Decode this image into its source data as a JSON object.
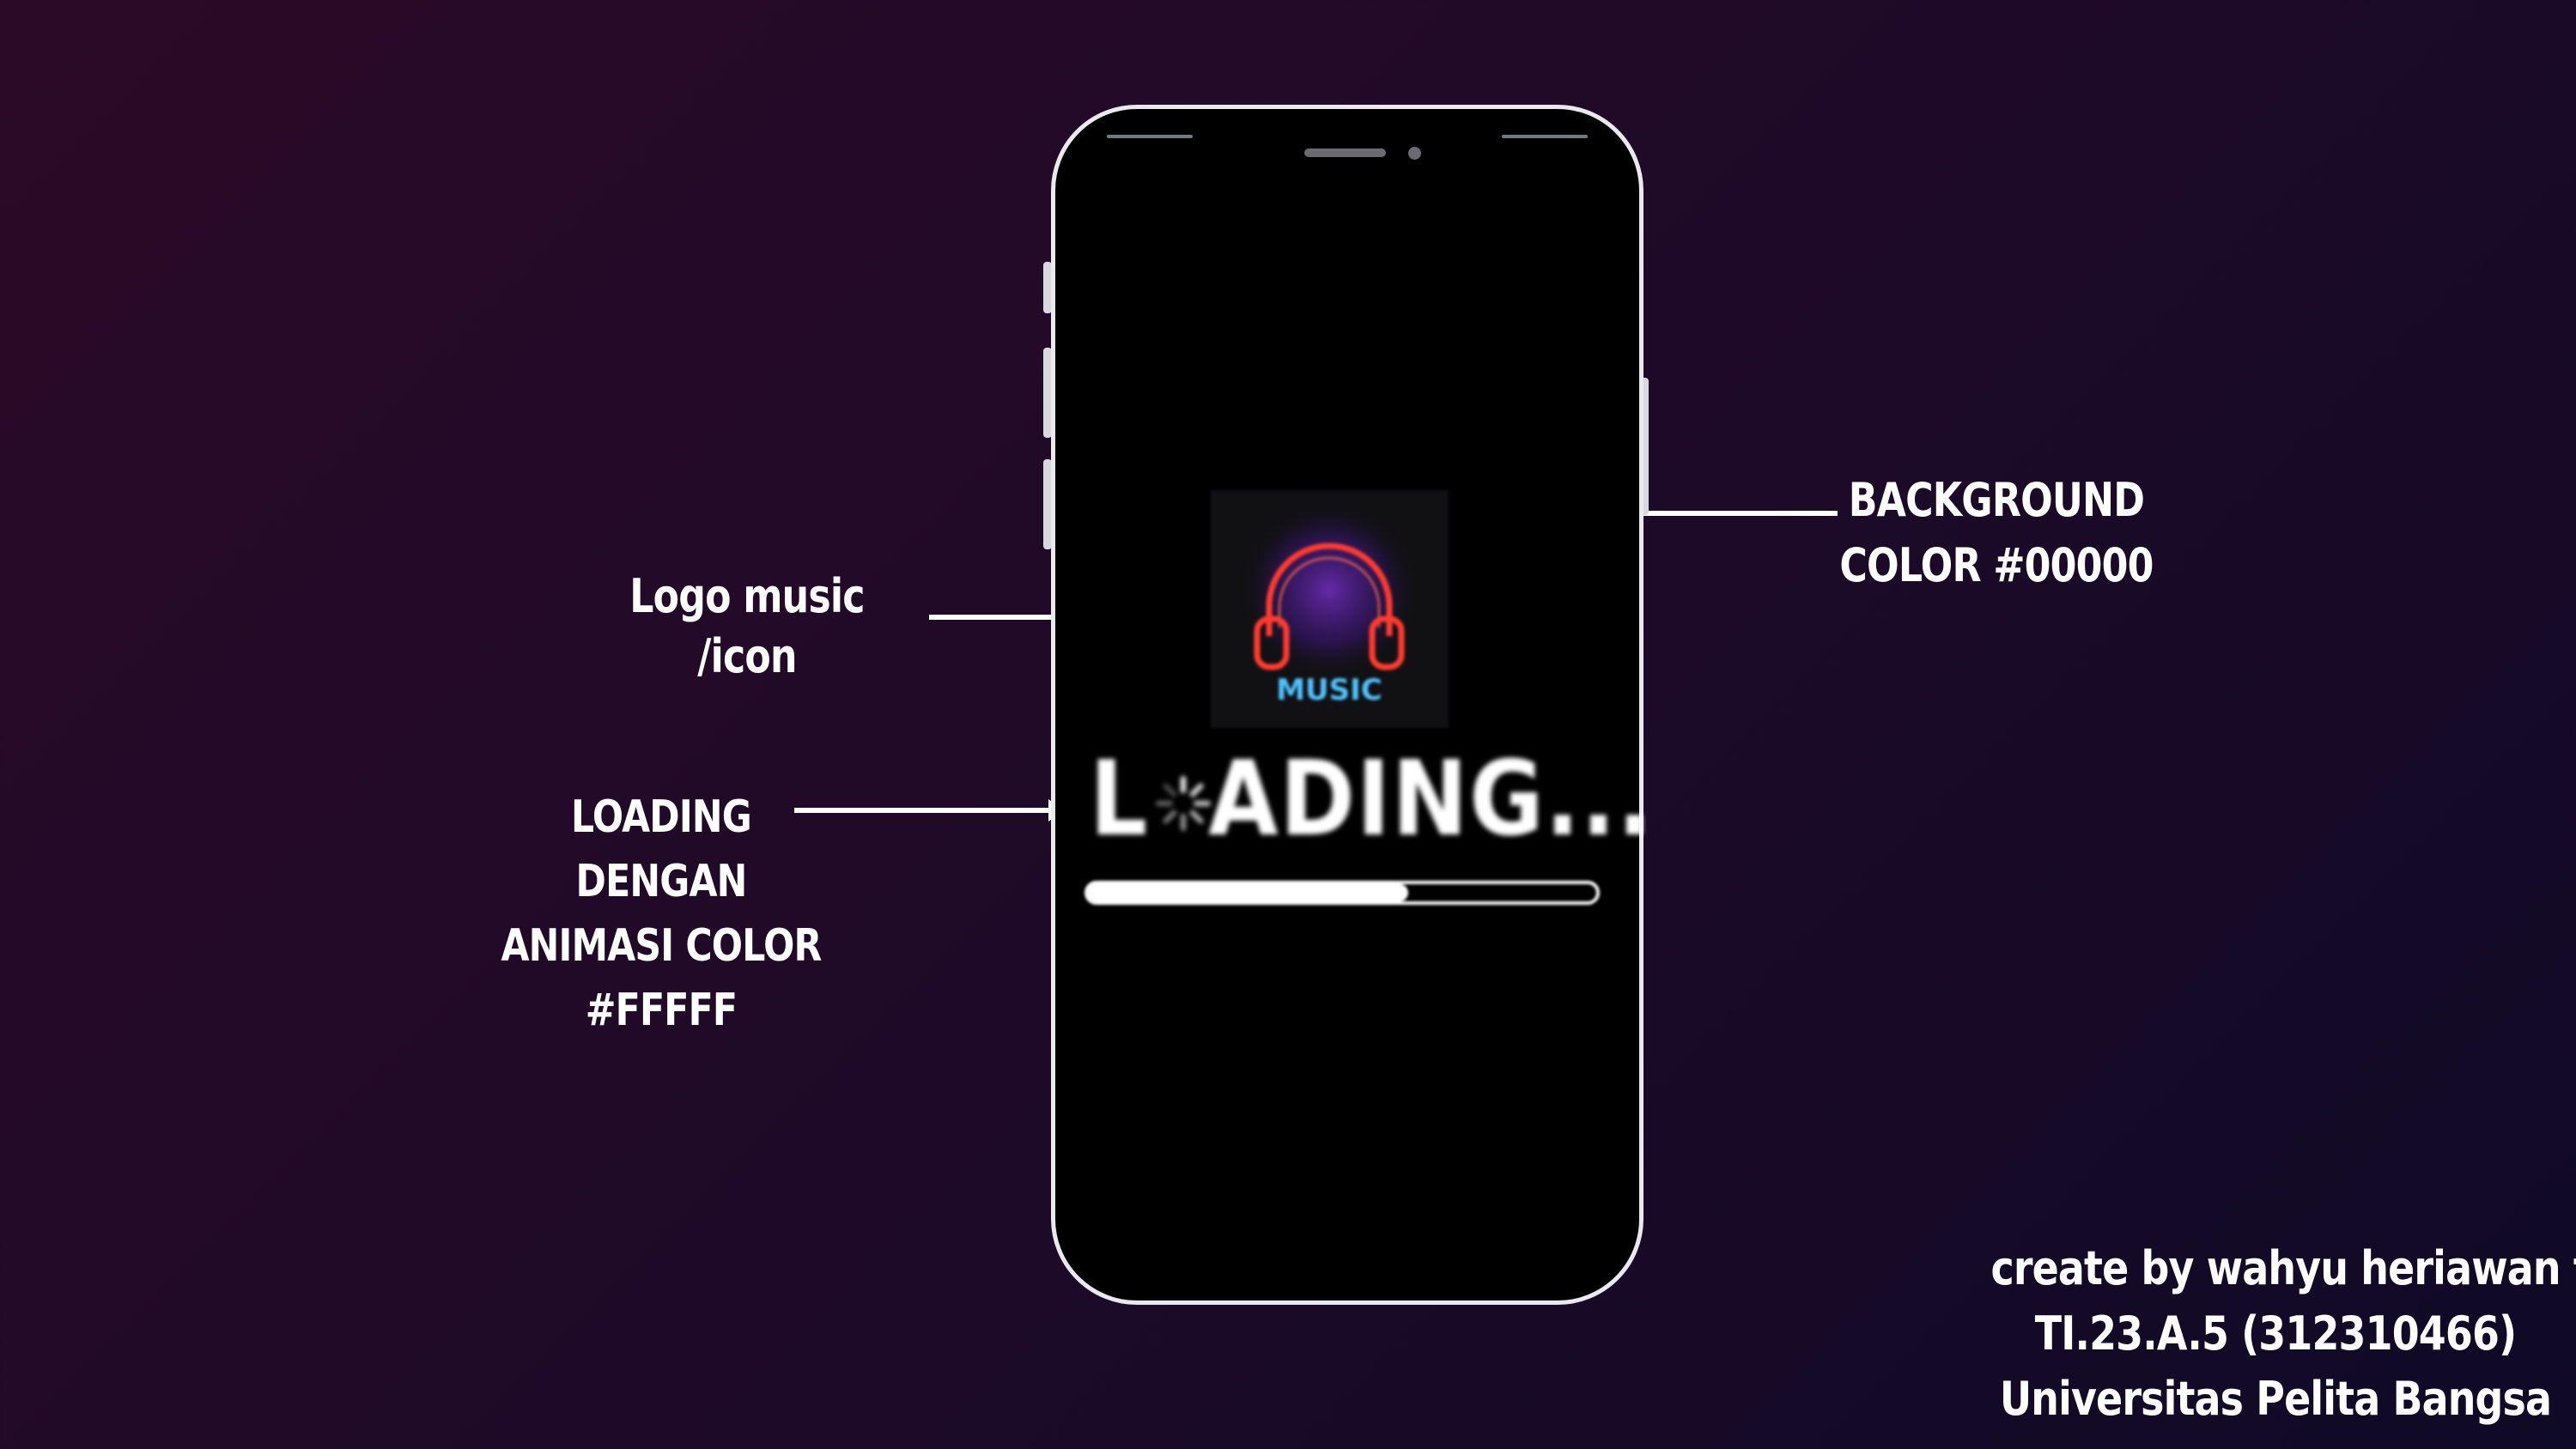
{
  "annotations": {
    "logo": [
      "Logo music",
      "/icon"
    ],
    "loading": [
      "LOADING",
      "DENGAN",
      "ANIMASI COLOR",
      "#FFFFF"
    ],
    "background": [
      "BACKGROUND",
      "COLOR #00000"
    ]
  },
  "credit": [
    "create by wahyu heriawan t.s",
    "TI.23.A.5 (312310466)",
    "Universitas Pelita Bangsa"
  ],
  "phone": {
    "screen_background": "#000000",
    "logo": {
      "icon": "headphones-icon",
      "label": "MUSIC",
      "headphone_color": "#ff3b2f",
      "label_color": "#4fc3ff",
      "glow_color": "#6a2bb0"
    },
    "loading": {
      "text_start": "L",
      "text_rest": "ADING...",
      "progress": 0.63,
      "color": "#ffffff"
    }
  }
}
